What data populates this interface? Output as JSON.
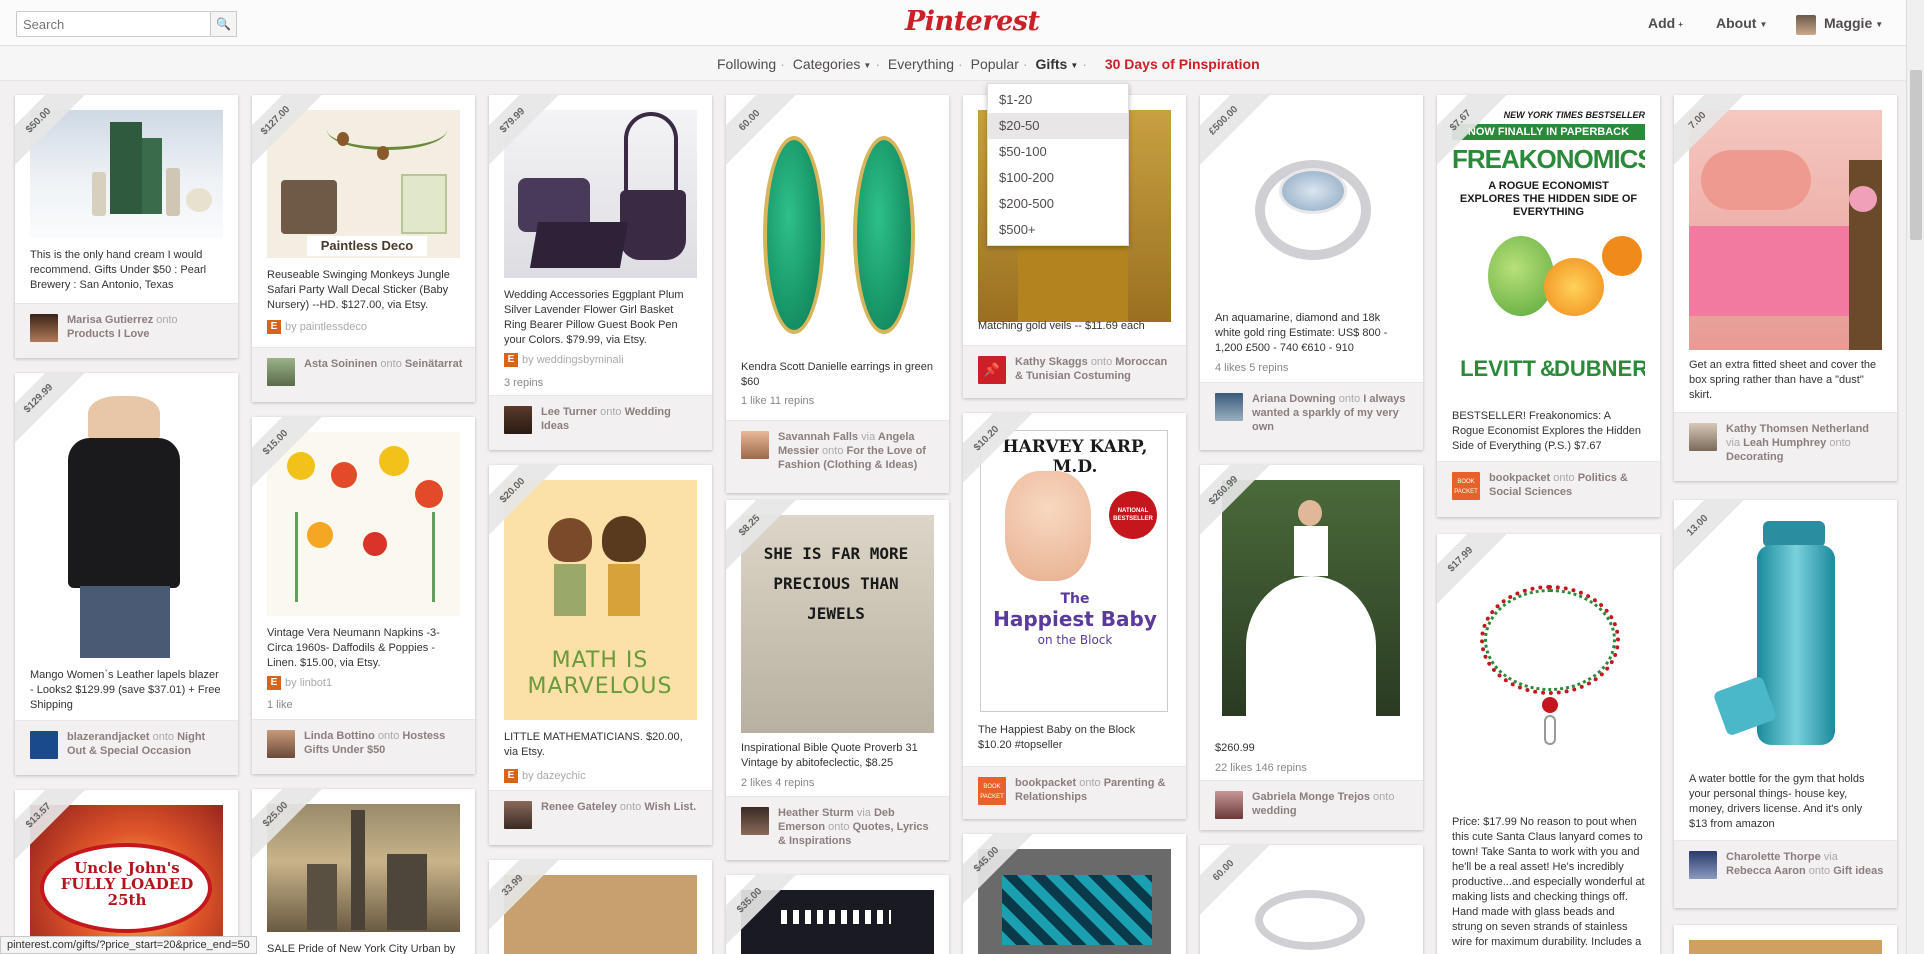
{
  "header": {
    "search_placeholder": "Search",
    "logo": "Pinterest",
    "add": "Add",
    "about": "About",
    "user": "Maggie"
  },
  "subnav": {
    "following": "Following",
    "categories": "Categories",
    "everything": "Everything",
    "popular": "Popular",
    "gifts": "Gifts",
    "featured": "30 Days of Pinspiration"
  },
  "gift_dropdown": [
    "$1-20",
    "$20-50",
    "$50-100",
    "$100-200",
    "$200-500",
    "$500+"
  ],
  "pins": [
    {
      "price": "$50.00",
      "desc": "This is the only hand cream I would recommend. Gifts Under $50 : Pearl Brewery : San Antonio, Texas",
      "user": "Marisa Gutierrez",
      "board": "Products I Love"
    },
    {
      "price": "$129.99",
      "desc": "Mango Women`s Leather lapels blazer - Looks2 $129.99 (save $37.01) + Free Shipping",
      "user": "blazerandjacket",
      "board": "Night Out & Special Occasion"
    },
    {
      "price": "$13.57",
      "desc": "",
      "user": "",
      "board": ""
    },
    {
      "price": "$127.00",
      "desc": "Reuseable Swinging Monkeys Jungle Safari Party Wall Decal Sticker (Baby Nursery) --HD. $127.00, via Etsy.",
      "via": "paintlessdeco",
      "user": "Asta Soininen",
      "board": "Seinätarrat"
    },
    {
      "price": "$15.00",
      "desc": "Vintage Vera Neumann Napkins -3- Circa 1960s- Daffodils & Poppies -Linen. $15.00, via Etsy.",
      "via": "linbot1",
      "stats": "1 like",
      "user": "Linda Bottino",
      "board": "Hostess Gifts Under $50"
    },
    {
      "price": "$25.00",
      "desc": "SALE Pride of New York City Urban by",
      "user": "",
      "board": ""
    },
    {
      "price": "$79.99",
      "desc": "Wedding Accessories Eggplant Plum Silver Lavender Flower Girl Basket Ring Bearer Pillow Guest Book Pen your Colors. $79.99, via Etsy.",
      "via": "weddingsbyminali",
      "stats": "3 repins",
      "user": "Lee Turner",
      "board": "Wedding Ideas"
    },
    {
      "price": "$20.00",
      "desc": "LITTLE MATHEMATICIANS. $20.00, via Etsy.",
      "via": "dazeychic",
      "user": "Renee Gateley",
      "board": "Wish List."
    },
    {
      "price": "33.99",
      "desc": "",
      "user": "",
      "board": ""
    },
    {
      "price": "60.00",
      "desc": "Kendra Scott Danielle earrings in green $60",
      "stats": "1 like   11 repins",
      "user": "Savannah Falls",
      "viauser": "Angela Messier",
      "board": "For the Love of Fashion (Clothing & Ideas)"
    },
    {
      "price": "$8.25",
      "desc": "Inspirational Bible Quote Proverb 31 Vintage by abitofeclectic, $8.25",
      "stats": "2 likes   4 repins",
      "user": "Heather Sturm",
      "viauser": "Deb Emerson",
      "board": "Quotes, Lyrics & Inspirations"
    },
    {
      "price": "$35.00",
      "desc": "",
      "user": "",
      "board": ""
    },
    {
      "price": "",
      "desc": "Matching gold veils -- $11.69 each",
      "user": "Kathy Skaggs",
      "board": "Moroccan & Tunisian Costuming"
    },
    {
      "price": "$10.20",
      "desc": "The Happiest Baby on the Block $10.20 #topseller",
      "user": "bookpacket",
      "board": "Parenting & Relationships"
    },
    {
      "price": "$45.00",
      "desc": "",
      "user": "",
      "board": ""
    },
    {
      "price": "£500.00",
      "desc": "An aquamarine, diamond and 18k white gold ring Estimate: US$ 800 - 1,200 £500 - 740 €610 - 910",
      "stats": "4 likes   5 repins",
      "user": "Ariana Downing",
      "board": "I always wanted a sparkly of my very own"
    },
    {
      "price": "$260.99",
      "desc": "$260.99",
      "stats": "22 likes   146 repins",
      "user": "Gabriela Monge Trejos",
      "board": "wedding"
    },
    {
      "price": "60.00",
      "desc": "",
      "user": "",
      "board": ""
    },
    {
      "price": "$7.67",
      "desc": "BESTSELLER! Freakonomics: A Rogue Economist Explores the Hidden Side of Everything (P.S.) $7.67",
      "user": "bookpacket",
      "board": "Politics & Social Sciences"
    },
    {
      "price": "$17.99",
      "desc": "Price: $17.99 No reason to pout when this cute Santa Claus lanyard comes to town! Take Santa to work with you and he'll be a real asset! He's incredibly productive...and especially wonderful at making lists and checking things off. Hand made with glass beads and strung on seven strands of stainless wire for maximum durability. Includes a",
      "user": "",
      "board": ""
    },
    {
      "price": "7.00",
      "desc": "Get an extra fitted sheet and cover the box spring rather than have a \"dust\" skirt.",
      "user": "Kathy Thomsen Netherland",
      "viauser": "Leah Humphrey",
      "board": "Decorating"
    },
    {
      "price": "13.00",
      "desc": "A water bottle for the gym that holds your personal things- house key, money, drivers license. And it's only $13 from amazon",
      "user": "Charolette Thorpe",
      "viauser": "Rebecca Aaron",
      "board": "Gift ideas"
    }
  ],
  "book_text": {
    "freak_banner": "NOW FINALLY IN PAPERBACK",
    "freak_nyt": "NEW YORK TIMES BESTSELLER",
    "freak_title": "FREAKONOMICS",
    "freak_sub": "A ROGUE ECONOMIST EXPLORES THE HIDDEN SIDE OF EVERYTHING",
    "freak_authors_1": "LEVITT",
    "freak_authors_2": "DUBNER",
    "freak_amp": "&",
    "karp_author": "HARVEY KARP, M.D.",
    "karp_title_1": "The",
    "karp_title_2": "Happiest Baby",
    "karp_title_3": "on the Block",
    "karp_badge": "NATIONAL BESTSELLER",
    "math_text": "MATH IS MARVELOUS",
    "bible_text": "SHE IS FAR MORE PRECIOUS THAN JEWELS",
    "decal_text": "Paintless Deco",
    "uncle_text": "Uncle John's FULLY LOADED 25th"
  },
  "on_word": "onto",
  "via_word": "via",
  "by_word": "by",
  "status_url": "pinterest.com/gifts/?price_start=20&price_end=50"
}
